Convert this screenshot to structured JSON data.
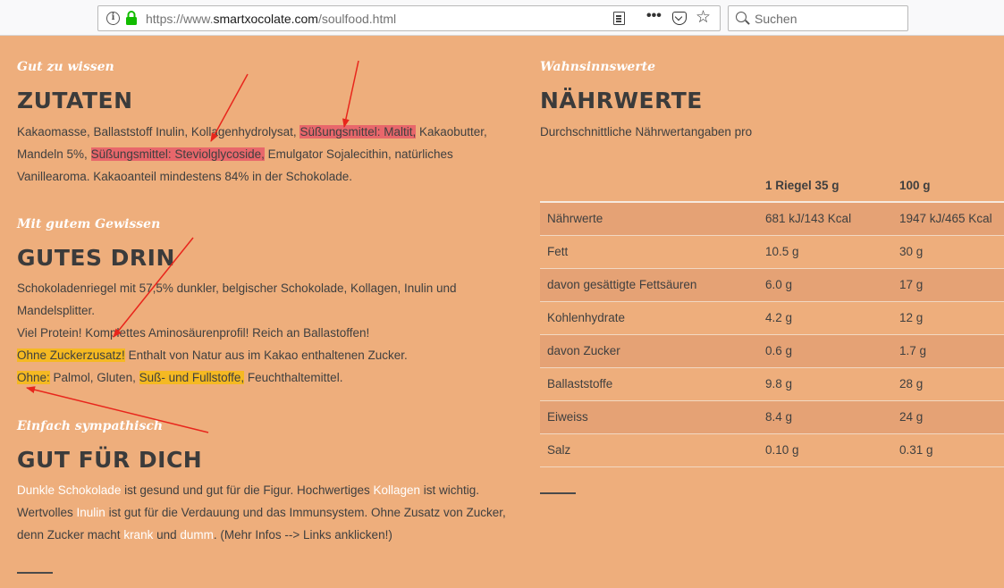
{
  "browser": {
    "url_prefix": "https://www.",
    "url_host": "smartxocolate.com",
    "url_path": "/soulfood.html",
    "info_icon": "i",
    "more_icon": "•••",
    "star_icon": "☆",
    "search_placeholder": "Suchen"
  },
  "colors": {
    "page_bg": "#eeae7c",
    "highlight_red": "#e8676b",
    "highlight_yellow": "#f5b922",
    "arrow": "#e8261c"
  },
  "left": {
    "zutaten": {
      "kicker": "Gut zu wissen",
      "title": "ZUTATEN",
      "l1a": "Kakaomasse, Ballaststoff Inulin, Kollagenhydrolysat, ",
      "l1b": "Süßungsmittel: Maltit,",
      "l1c": " Kakaobutter,",
      "l2a": "Mandeln 5%, ",
      "l2b": "Süßungsmittel: Steviolglycoside,",
      "l2c": " Emulgator Sojalecithin, natürliches",
      "l3": "Vanillearoma. Kakaoanteil mindestens 84% in der Schokolade."
    },
    "gutes": {
      "kicker": "Mit gutem Gewissen",
      "title": "GUTES DRIN",
      "l1": "Schokoladenriegel mit 57,5% dunkler, belgischer Schokolade, Kollagen, Inulin und",
      "l2": "Mandelsplitter.",
      "l3": "Viel Protein! Komplettes Aminosäurenprofil! Reich an Ballastoffen!",
      "l4a": "Ohne Zuckerzusatz!",
      "l4b": " Enthalt von Natur aus im Kakao enthaltenen Zucker.",
      "l5a": "Ohne:",
      "l5b": " Palmol, Gluten, ",
      "l5c": "Suß- und Fullstoffe,",
      "l5d": " Feuchthaltemittel."
    },
    "gut": {
      "kicker": "Einfach sympathisch",
      "title": "GUT FÜR DICH",
      "l1a": "Dunkle Schokolade",
      "l1b": " ist gesund und gut für die Figur. Hochwertiges ",
      "l1c": "Kollagen",
      "l1d": " ist wichtig.",
      "l2a": "Wertvolles ",
      "l2b": "Inulin",
      "l2c": " ist gut für die Verdauung und das Immunsystem. Ohne Zusatz von Zucker,",
      "l3a": "denn Zucker macht ",
      "l3b": "krank",
      "l3c": " und ",
      "l3d": "dumm",
      "l3e": ". (Mehr Infos --> Links anklicken!)"
    }
  },
  "right": {
    "kicker": "Wahnsinnswerte",
    "title": "NÄHRWERTE",
    "subtitle": "Durchschnittliche Nährwertangaben pro",
    "table": {
      "headers": [
        "",
        "1 Riegel 35 g",
        "100 g"
      ],
      "rows": [
        [
          "Nährwerte",
          "681 kJ/143 Kcal",
          "1947 kJ/465 Kcal"
        ],
        [
          "Fett",
          "10.5 g",
          "30 g"
        ],
        [
          "davon gesättigte Fettsäuren",
          "6.0 g",
          "17 g"
        ],
        [
          "Kohlenhydrate",
          "4.2 g",
          "12 g"
        ],
        [
          "davon Zucker",
          "0.6 g",
          "1.7 g"
        ],
        [
          "Ballaststoffe",
          "9.8 g",
          "28 g"
        ],
        [
          "Eiweiss",
          "8.4 g",
          "24 g"
        ],
        [
          "Salz",
          "0.10 g",
          "0.31 g"
        ]
      ]
    }
  }
}
